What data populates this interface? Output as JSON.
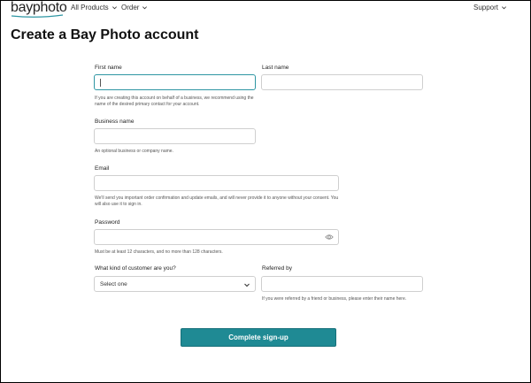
{
  "header": {
    "logo": "bayphoto",
    "nav": [
      {
        "label": "All Products"
      },
      {
        "label": "Order"
      }
    ],
    "support_label": "Support"
  },
  "page": {
    "title": "Create a Bay Photo account"
  },
  "form": {
    "first_name": {
      "label": "First name",
      "value": "",
      "help": "If you are creating this account on behalf of a business, we recommend using the name of the desired primary contact for your account."
    },
    "last_name": {
      "label": "Last name",
      "value": ""
    },
    "business_name": {
      "label": "Business name",
      "value": "",
      "help": "An optional business or company name."
    },
    "email": {
      "label": "Email",
      "value": "",
      "help": "We'll send you important order confirmation and update emails, and will never provide it to anyone without your consent. You will also use it to sign in."
    },
    "password": {
      "label": "Password",
      "value": "",
      "help": "Must be at least 12 characters, and no more than 128 characters."
    },
    "customer_type": {
      "label": "What kind of customer are you?",
      "selected": "Select one"
    },
    "referred_by": {
      "label": "Referred by",
      "value": "",
      "help": "If you were referred by a friend or business, please enter their name here."
    },
    "submit_label": "Complete sign-up"
  },
  "colors": {
    "accent": "#1f8a94",
    "focus_border": "#2e96a3"
  },
  "icons": [
    "chevron-down-icon",
    "eye-icon"
  ]
}
